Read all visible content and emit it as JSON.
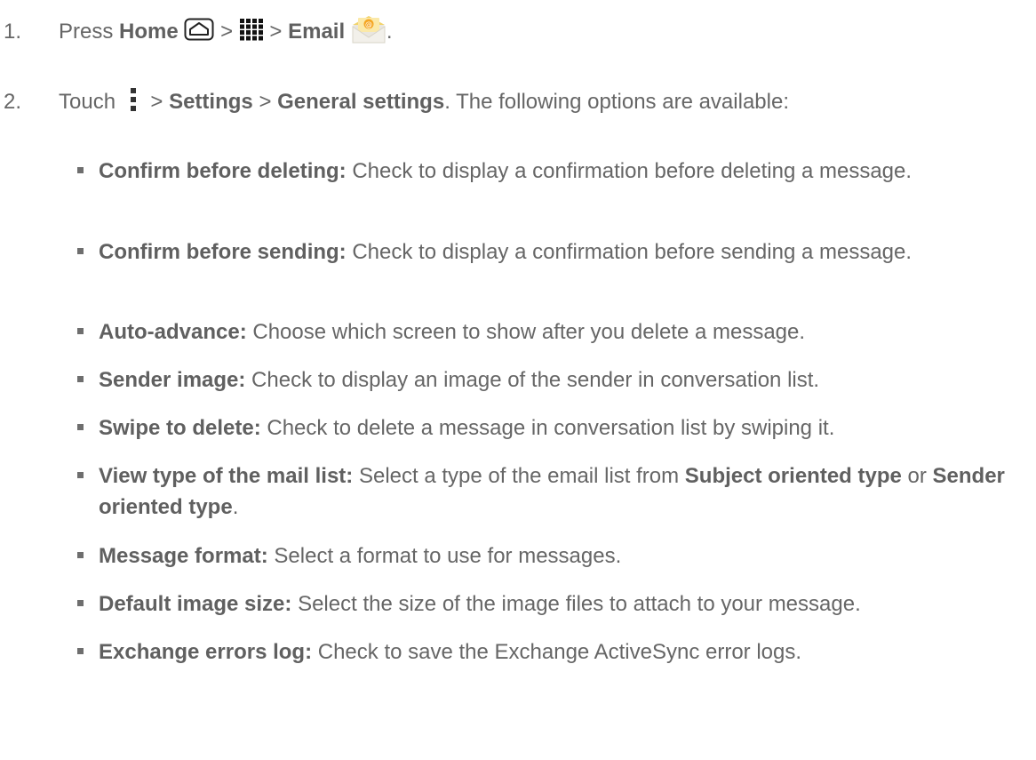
{
  "steps": [
    {
      "number": "1.",
      "press": "Press",
      "home": "Home",
      "sep1": ">",
      "sep2": ">",
      "email": "Email",
      "end": "."
    },
    {
      "number": "2.",
      "touch": "Touch",
      "sep1": ">",
      "settings": "Settings",
      "sep2": ">",
      "general": "General settings",
      "tail": ". The following options are available:"
    }
  ],
  "options": [
    {
      "term": "Confirm before deleting:",
      "desc": " Check to display a confirmation before deleting a message."
    },
    {
      "term": "Confirm before sending:",
      "desc": " Check to display a confirmation before sending a message."
    },
    {
      "term": "Auto-advance:",
      "desc": " Choose which screen to show after you delete a message."
    },
    {
      "term": "Sender image:",
      "desc": " Check to display an image of the sender in conversation list."
    },
    {
      "term": "Swipe to delete:",
      "desc": " Check to delete a message in conversation list by swiping it."
    },
    {
      "term": "View type of the mail list:",
      "desc": " Select a type of the email list from ",
      "choice1": "Subject oriented type",
      "mid": " or ",
      "choice2": "Sender oriented type",
      "end": "."
    },
    {
      "term": "Message format:",
      "desc": " Select a format to use for messages."
    },
    {
      "term": "Default image size:",
      "desc": " Select the size of the image files to attach to your message."
    },
    {
      "term": "Exchange errors log:",
      "desc": " Check to save the Exchange ActiveSync error logs."
    }
  ],
  "icons": {
    "home": "home-key-icon",
    "apps": "apps-grid-icon",
    "email": "email-app-icon",
    "menu": "menu-overflow-icon"
  },
  "colors": {
    "text": "#666666",
    "icon": "#333333",
    "email_envelope": "#f2d36b",
    "email_accent": "#f5a623"
  }
}
